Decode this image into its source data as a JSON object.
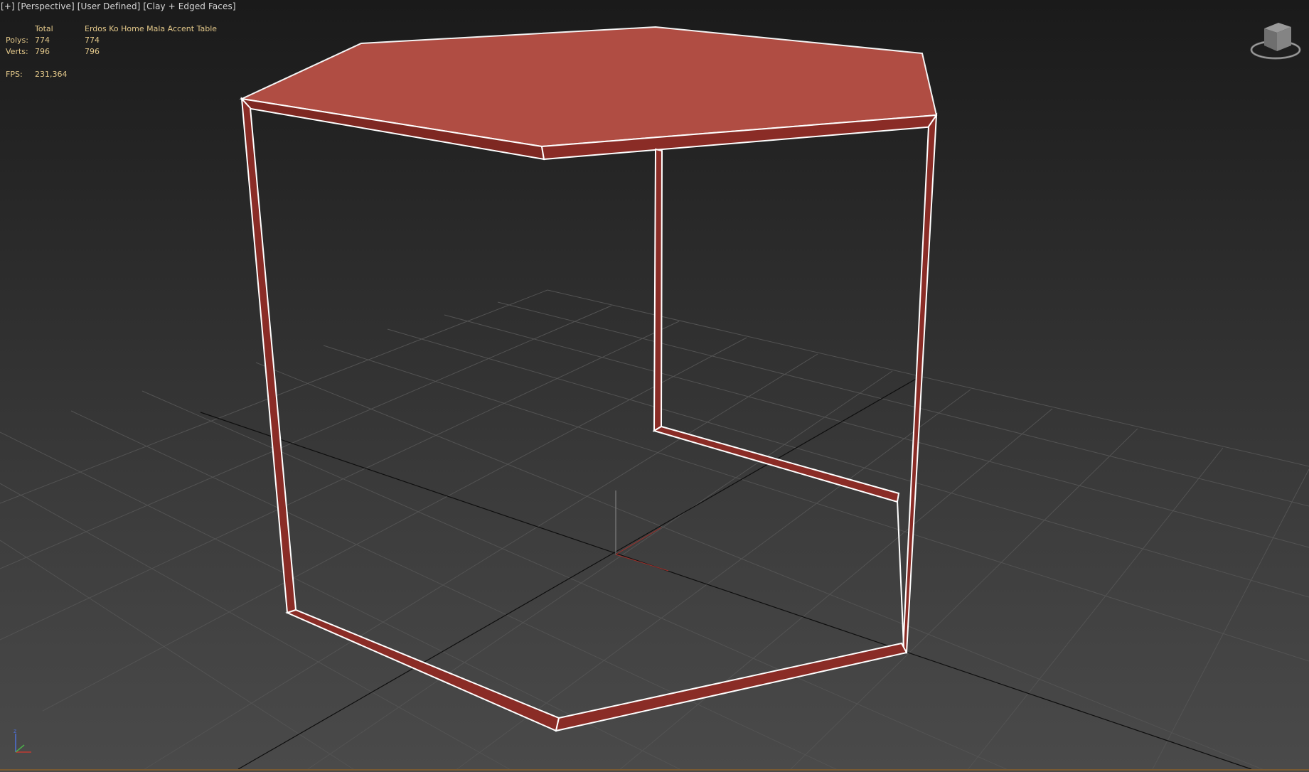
{
  "viewport": {
    "label_parts": [
      "[+]",
      "[Perspective]",
      "[User Defined]",
      "[Clay + Edged Faces]"
    ]
  },
  "stats": {
    "header_total": "Total",
    "header_object": "Erdos Ko Home Mala Accent Table",
    "polys_label": "Polys:",
    "polys_total": "774",
    "polys_object": "774",
    "verts_label": "Verts:",
    "verts_total": "796",
    "verts_object": "796",
    "fps_label": "FPS:",
    "fps_value": "231,364"
  },
  "colors": {
    "table_top": "#b04d43",
    "frame_side": "#8a2c26",
    "edge": "#ffffff",
    "grid": "#525252",
    "world_axis": "#101010",
    "stats_text": "#e3c88a",
    "label_text": "#d8d8d8"
  },
  "viewcube": {
    "icon": "viewcube-icon"
  },
  "tripod": {
    "icon": "axis-tripod-icon"
  }
}
